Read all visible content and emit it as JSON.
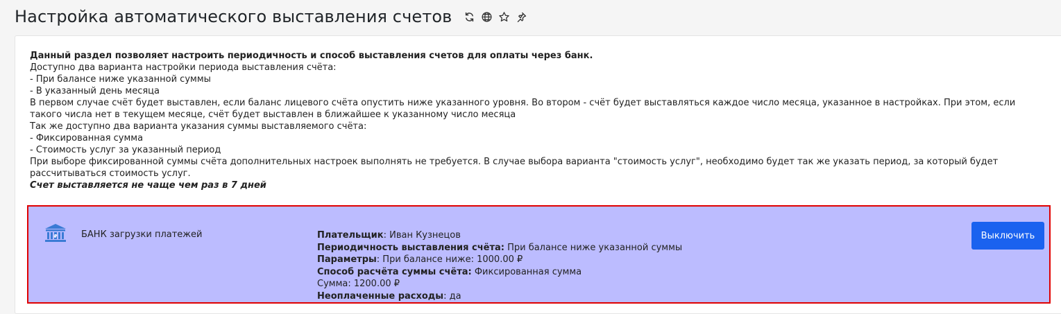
{
  "page": {
    "title": "Настройка автоматического выставления счетов",
    "icons": [
      "refresh-icon",
      "globe-icon",
      "star-icon",
      "pin-icon"
    ]
  },
  "description": {
    "intro_bold": "Данный раздел позволяет настроить периодичность и способ выставления счетов для оплаты через банк.",
    "period_header": "Доступно два варианта настройки периода выставления счёта:",
    "period_opt1": "- При балансе ниже указанной суммы",
    "period_opt2": "- В указанный день месяца",
    "period_explain": "В первом случае счёт будет выставлен, если баланс лицевого счёта опустить ниже указанного уровня. Во втором - счёт будет выставляться каждое число месяца, указанное в настройках. При этом, если такого числа нет в текущем месяце, счёт будет выставлен в ближайшее к указанному число месяца",
    "sum_header": "Так же доступно два варианта указания суммы выставляемого счёта:",
    "sum_opt1": "- Фиксированная сумма",
    "sum_opt2": "- Стоимость услуг за указанный период",
    "sum_explain": "При выборе фиксированной суммы счёта дополнительных настроек выполнять не требуется. В случае выбора варианта \"стоимость услуг\", необходимо будет так же указать период, за который будет рассчитываться стоимость услуг.",
    "note": "Счет выставляется не чаще чем раз в 7 дней"
  },
  "bank": {
    "icon": "bank-icon",
    "name": "БАНК загрузки платежей",
    "payer_label": "Плательщик",
    "payer_value": ": Иван Кузнецов",
    "period_label": "Периодичность выставления счёта:",
    "period_value": " При балансе ниже указанной суммы",
    "params_label": "Параметры",
    "params_value": ": При балансе ниже: 1000.00 ₽",
    "method_label": "Способ расчёта суммы счёта:",
    "method_value": " Фиксированная сумма",
    "sum_line": "Сумма: 1200.00 ₽",
    "unpaid_label": "Неоплаченные расходы",
    "unpaid_value": ": да",
    "disable_button": "Выключить",
    "accent_color": "#1a62ef",
    "box_color": "#bcbcff",
    "highlight_border": "#e00000"
  }
}
